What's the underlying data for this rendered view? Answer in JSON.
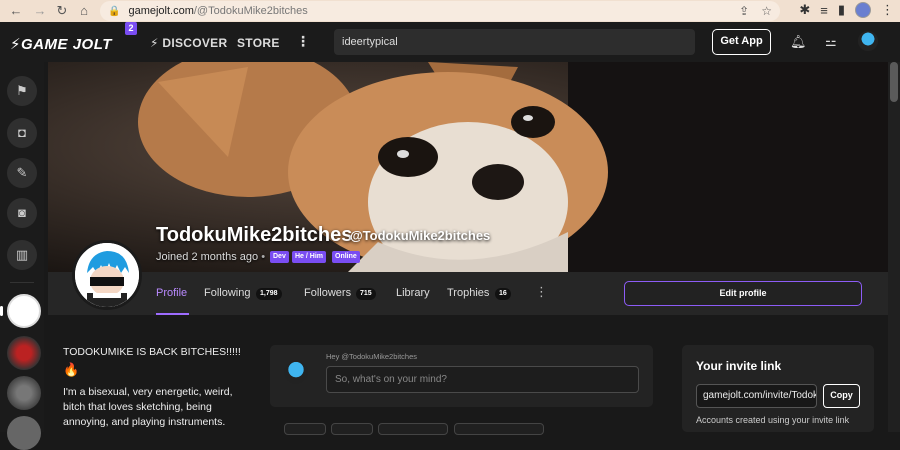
{
  "browser": {
    "url_host": "gamejolt.com",
    "url_path": "/@TodokuMike2bitches",
    "back_icon": "arrow-left-icon",
    "forward_icon": "arrow-right-icon",
    "reload_icon": "reload-icon",
    "home_icon": "home-icon",
    "lock_icon": "lock-icon"
  },
  "topbar": {
    "logo": "GAME JOLT",
    "logo_badge": "2",
    "discover": "DISCOVER",
    "store": "STORE",
    "search_value": "ideertypical",
    "get_app": "Get App"
  },
  "profile": {
    "name": "TodokuMike2bitches",
    "handle": "@TodokuMike2bitches",
    "joined": "Joined 2 months ago",
    "tags": [
      "Dev",
      "He / Him",
      "Online"
    ]
  },
  "tabs": {
    "profile": "Profile",
    "following": "Following",
    "following_count": "1,798",
    "followers": "Followers",
    "followers_count": "715",
    "library": "Library",
    "trophies": "Trophies",
    "trophies_count": "16",
    "edit_profile": "Edit profile"
  },
  "bio": {
    "line1": "TODOKUMIKE IS BACK BITCHES!!!!!",
    "emoji": "🔥",
    "line2": "I'm a bisexual, very energetic, weird, bitch that loves sketching, being annoying, and playing instruments."
  },
  "post": {
    "hey": "Hey @TodokuMike2bitches",
    "placeholder": "So, what's on your mind?"
  },
  "invite": {
    "title": "Your invite link",
    "link": "gamejolt.com/invite/Todoku",
    "copy": "Copy",
    "desc": "Accounts created using your invite link"
  },
  "colors": {
    "accent": "#9e6cff",
    "tag_bg": "#7a4df2",
    "background": "#191919"
  }
}
